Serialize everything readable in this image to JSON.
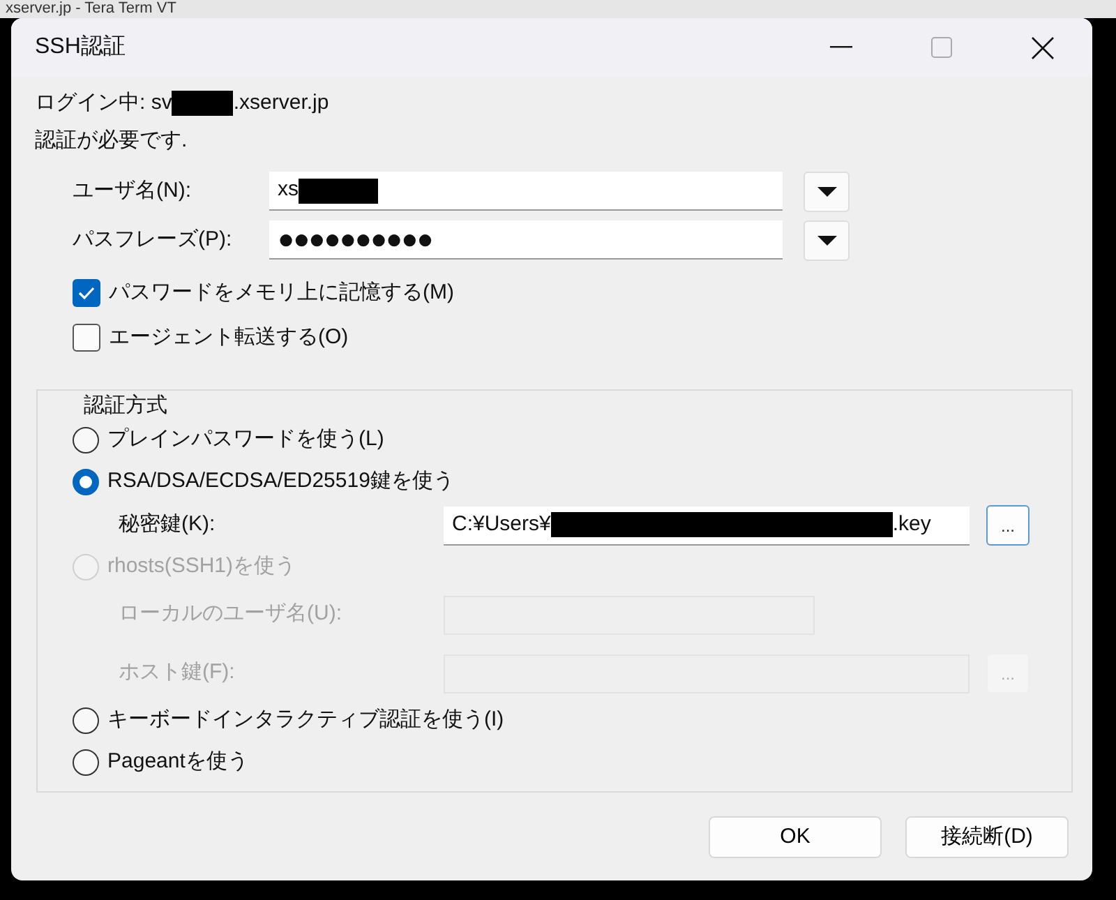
{
  "background_window": {
    "title": "xserver.jp - Tera Term VT"
  },
  "window": {
    "title": "SSH認証"
  },
  "login": {
    "label": "ログイン中: sv",
    "suffix": ".xserver.jp",
    "redacted": true
  },
  "message": "認証が必要です.",
  "username": {
    "label": "ユーザ名(N):",
    "value": "xs",
    "redacted": true
  },
  "passphrase": {
    "label": "パスフレーズ(P):",
    "value": "●●●●●●●●●●"
  },
  "options": [
    {
      "label": "パスワードをメモリ上に記憶する(M)",
      "checked": true
    },
    {
      "label": "エージェント転送する(O)",
      "checked": false
    }
  ],
  "auth_method": {
    "title": "認証方式",
    "methods": [
      {
        "label": "プレインパスワードを使う(L)",
        "selected": false,
        "disabled": false
      },
      {
        "label": "RSA/DSA/ECDSA/ED25519鍵を使う",
        "selected": true,
        "disabled": false,
        "fields": [
          {
            "kind": "key",
            "label": "秘密鍵(K):",
            "value": "C:¥Users¥",
            "suffix": ".key",
            "redacted": true,
            "browse": "...",
            "disabled": false
          }
        ]
      },
      {
        "label": "rhosts(SSH1)を使う",
        "selected": false,
        "disabled": true,
        "fields": [
          {
            "kind": "local",
            "label": "ローカルのユーザ名(U):",
            "disabled": true
          },
          {
            "kind": "host",
            "label": "ホスト鍵(F):",
            "browse": "...",
            "disabled": true
          }
        ]
      },
      {
        "label": "キーボードインタラクティブ認証を使う(I)",
        "selected": false,
        "disabled": false
      },
      {
        "label": "Pageantを使う",
        "selected": false,
        "disabled": false
      }
    ]
  },
  "buttons": [
    {
      "label": "OK"
    },
    {
      "label": "接続断(D)"
    }
  ]
}
